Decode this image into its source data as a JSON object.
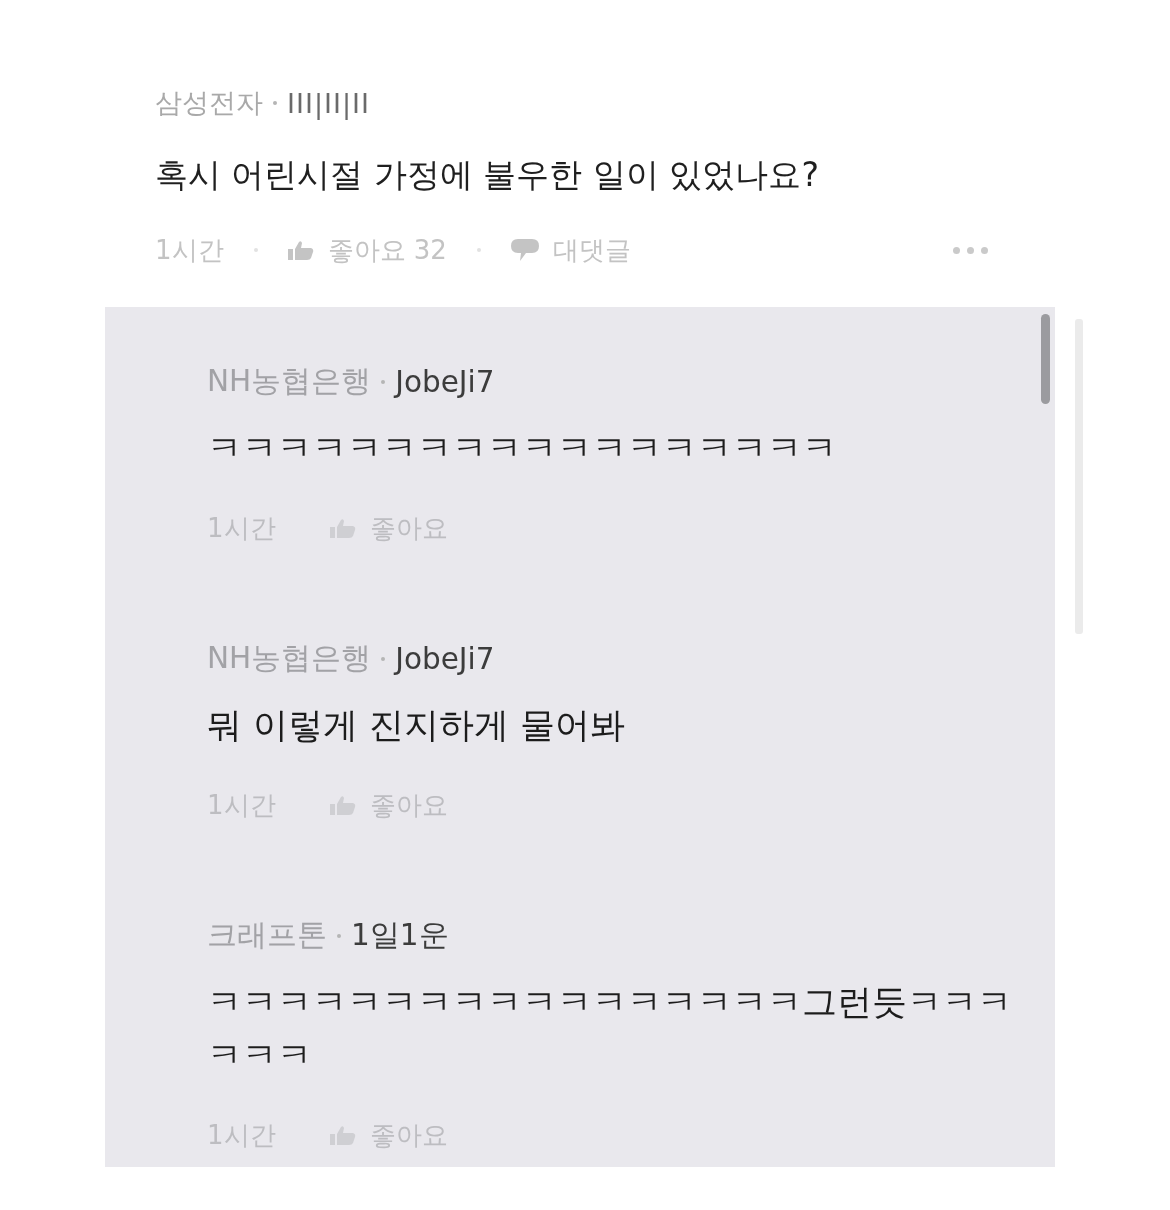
{
  "post": {
    "author": "삼성전자",
    "username": "III|II|II",
    "text": "혹시 어린시절 가정에 불우한 일이 있었나요?",
    "time": "1시간",
    "like_label": "좋아요 32",
    "reply_label": "대댓글"
  },
  "replies": [
    {
      "author": "NH농협은행",
      "username": "JobeJi7",
      "text": "ㅋㅋㅋㅋㅋㅋㅋㅋㅋㅋㅋㅋㅋㅋㅋㅋㅋㅋ",
      "time": "1시간",
      "like_label": "좋아요"
    },
    {
      "author": "NH농협은행",
      "username": "JobeJi7",
      "text": "뭐 이렇게 진지하게 물어봐",
      "time": "1시간",
      "like_label": "좋아요"
    },
    {
      "author": "크래프톤",
      "username": "1일1운",
      "text": "ㅋㅋㅋㅋㅋㅋㅋㅋㅋㅋㅋㅋㅋㅋㅋㅋㅋ그런듯ㅋㅋㅋㅋㅋㅋ",
      "time": "1시간",
      "like_label": "좋아요"
    }
  ]
}
